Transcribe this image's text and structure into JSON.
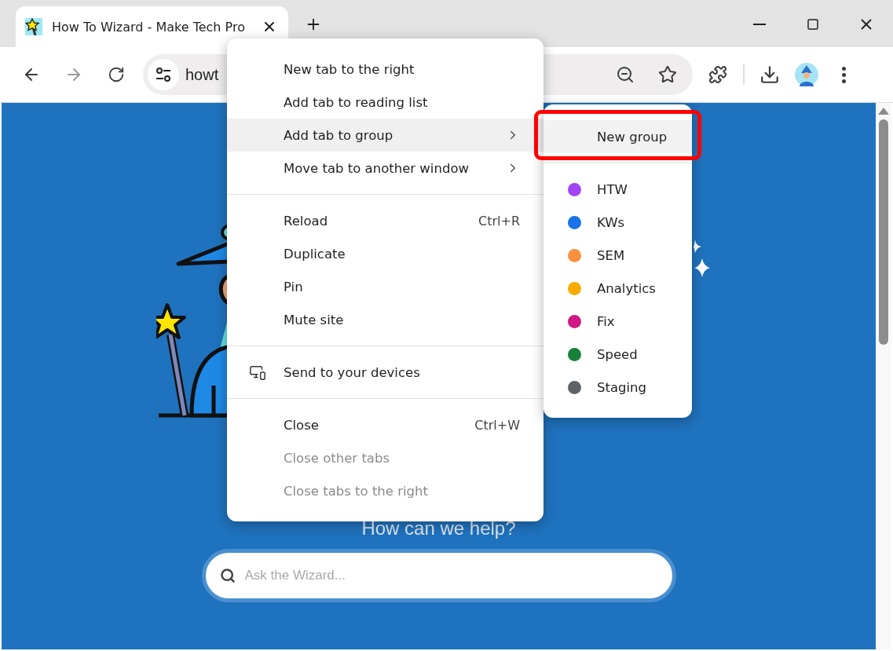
{
  "browser": {
    "tab": {
      "title": "How To Wizard - Make Tech Pro",
      "selected": true
    },
    "address": "howt"
  },
  "page": {
    "heading": "How can we help?",
    "search": {
      "placeholder": "Ask the Wizard..."
    }
  },
  "context_menu": {
    "sections": [
      {
        "items": [
          {
            "label": "New tab to the right",
            "kind": "plain",
            "highlighted": false,
            "disabled": false,
            "has_submenu": false
          },
          {
            "label": "Add tab to reading list",
            "kind": "plain",
            "highlighted": false,
            "disabled": false,
            "has_submenu": false
          },
          {
            "label": "Add tab to group",
            "kind": "plain",
            "highlighted": true,
            "disabled": false,
            "has_submenu": true
          },
          {
            "label": "Move tab to another window",
            "kind": "plain",
            "highlighted": false,
            "disabled": false,
            "has_submenu": true
          }
        ]
      },
      {
        "items": [
          {
            "label": "Reload",
            "shortcut": "Ctrl+R",
            "kind": "plain",
            "highlighted": false,
            "disabled": false,
            "has_submenu": false
          },
          {
            "label": "Duplicate",
            "kind": "plain",
            "highlighted": false,
            "disabled": false,
            "has_submenu": false
          },
          {
            "label": "Pin",
            "kind": "plain",
            "highlighted": false,
            "disabled": false,
            "has_submenu": false
          },
          {
            "label": "Mute site",
            "kind": "plain",
            "highlighted": false,
            "disabled": false,
            "has_submenu": false
          }
        ]
      },
      {
        "items": [
          {
            "label": "Send to your devices",
            "kind": "device",
            "highlighted": false,
            "disabled": false,
            "has_submenu": false
          }
        ]
      },
      {
        "items": [
          {
            "label": "Close",
            "shortcut": "Ctrl+W",
            "kind": "plain",
            "highlighted": false,
            "disabled": false,
            "has_submenu": false
          },
          {
            "label": "Close other tabs",
            "kind": "plain",
            "highlighted": false,
            "disabled": true,
            "has_submenu": false
          },
          {
            "label": "Close tabs to the right",
            "kind": "plain",
            "highlighted": false,
            "disabled": true,
            "has_submenu": false
          }
        ]
      }
    ]
  },
  "group_submenu": {
    "new_group": {
      "label": "New group",
      "highlighted": true,
      "annotated": true
    },
    "groups": [
      {
        "label": "HTW",
        "color": "#a142f4"
      },
      {
        "label": "KWs",
        "color": "#1a73e8"
      },
      {
        "label": "SEM",
        "color": "#fa903e"
      },
      {
        "label": "Analytics",
        "color": "#f9ab00"
      },
      {
        "label": "Fix",
        "color": "#d01884"
      },
      {
        "label": "Speed",
        "color": "#188038"
      },
      {
        "label": "Staging",
        "color": "#5f6368"
      }
    ]
  }
}
